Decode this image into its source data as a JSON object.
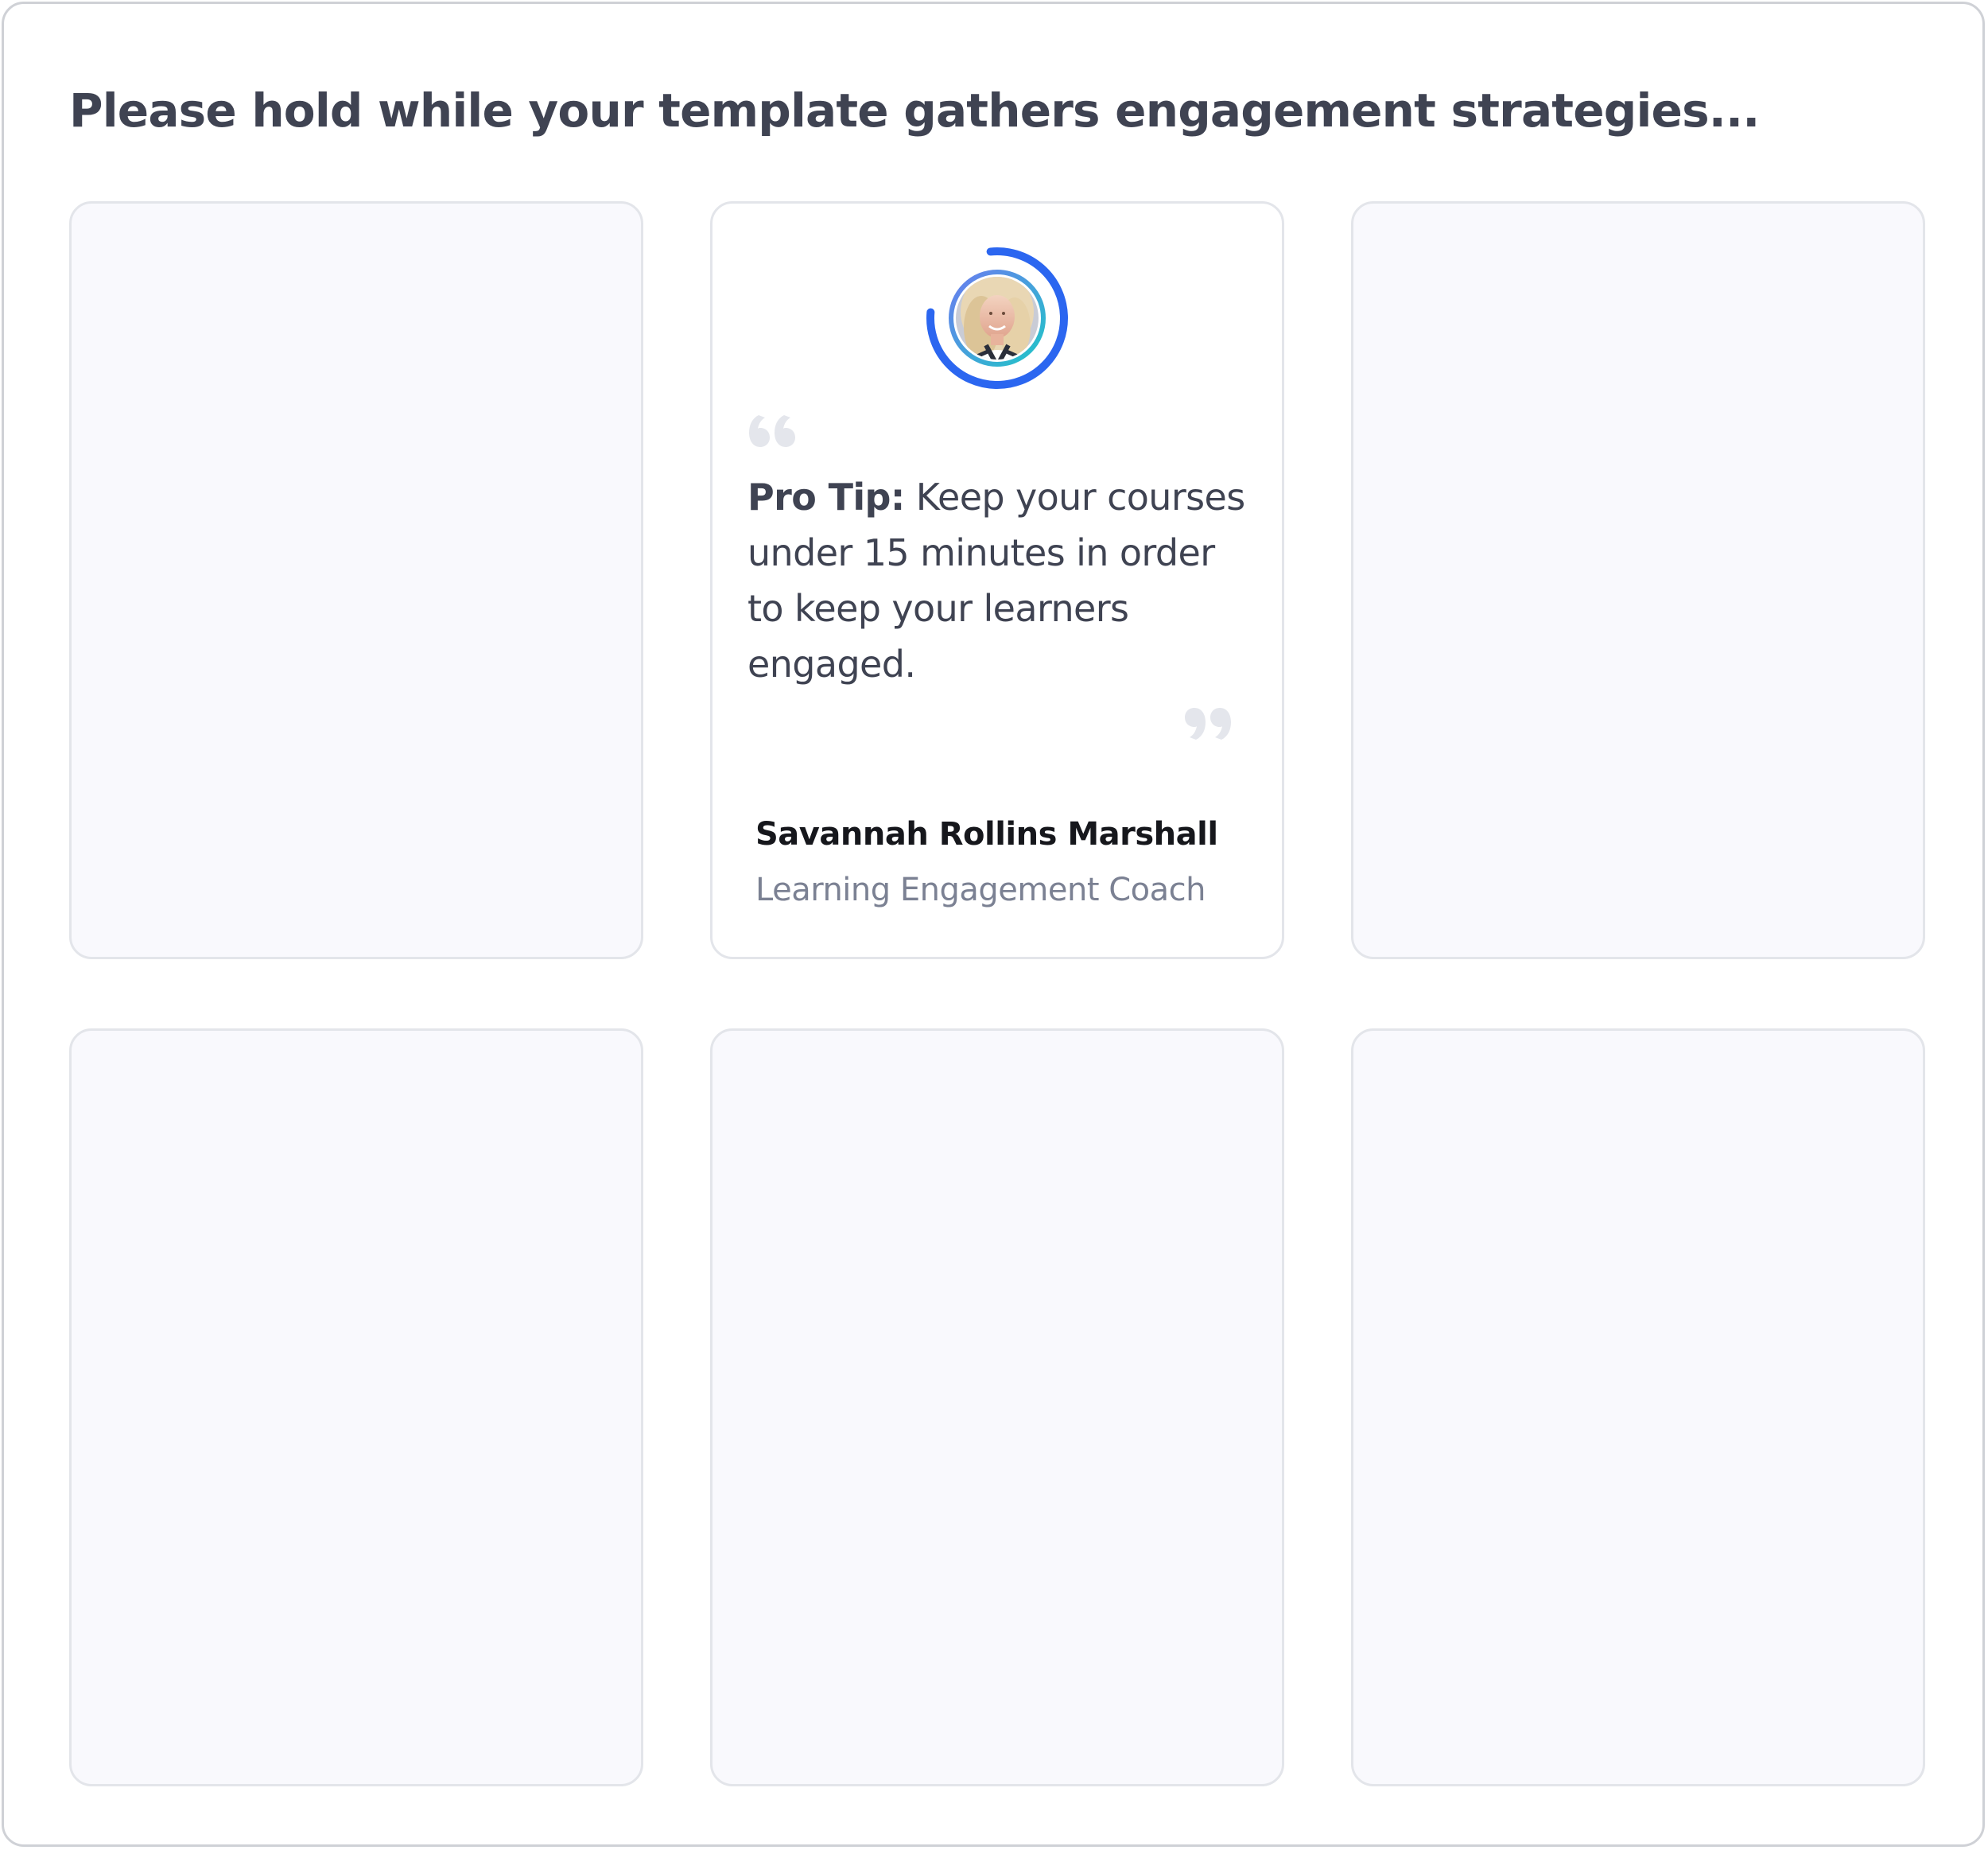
{
  "page": {
    "heading": "Please hold while your template gathers engagement strategies..."
  },
  "tip_card": {
    "avatar_icon": "person-photo-avatar",
    "progress": 0.78,
    "progress_color": "#2b66f0",
    "ring_accent_colors": [
      "#20c5c7",
      "#6b7cf0"
    ],
    "quote_open_icon": "quote-open-icon",
    "quote_close_icon": "quote-close-icon",
    "tip_label": "Pro Tip:",
    "tip_text": "Keep your courses under 15 minutes in order to keep your learners engaged.",
    "author_name": "Savannah Rollins Marshall",
    "author_role": "Learning Engagement Coach"
  },
  "placeholder_cards": [
    {
      "state": "loading"
    },
    {
      "state": "loading"
    },
    {
      "state": "loading"
    },
    {
      "state": "loading"
    },
    {
      "state": "loading"
    }
  ]
}
